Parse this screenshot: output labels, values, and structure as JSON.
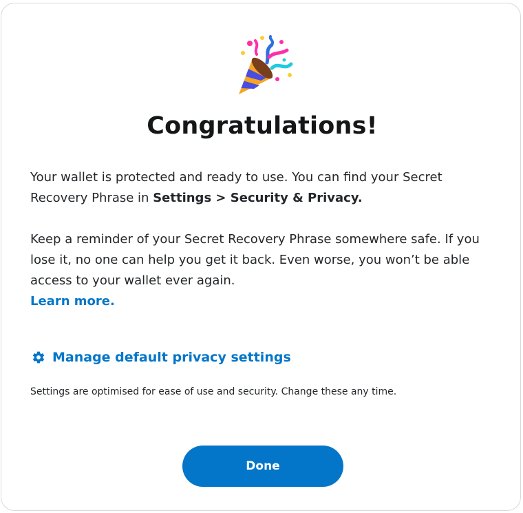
{
  "header": {
    "icon": "party-popper-icon",
    "title": "Congratulations!"
  },
  "content": {
    "p1_prefix": "Your wallet is protected and ready to use. You can find your Secret Recovery Phrase in ",
    "p1_bold": "Settings > Security & Privacy.",
    "p2_text": "Keep a reminder of your Secret Recovery Phrase somewhere safe. If you lose it, no one can help you get it back. Even worse, you won’t be able access to your wallet ever again.",
    "learn_more_label": "Learn more."
  },
  "privacy": {
    "icon": "gear-icon",
    "manage_label": "Manage default privacy settings",
    "note": "Settings are optimised for ease of use and security. Change these any time."
  },
  "actions": {
    "done_label": "Done"
  },
  "colors": {
    "primary": "#0376c9",
    "text": "#24272a",
    "heading": "#141618",
    "border": "#d6d9dc"
  }
}
